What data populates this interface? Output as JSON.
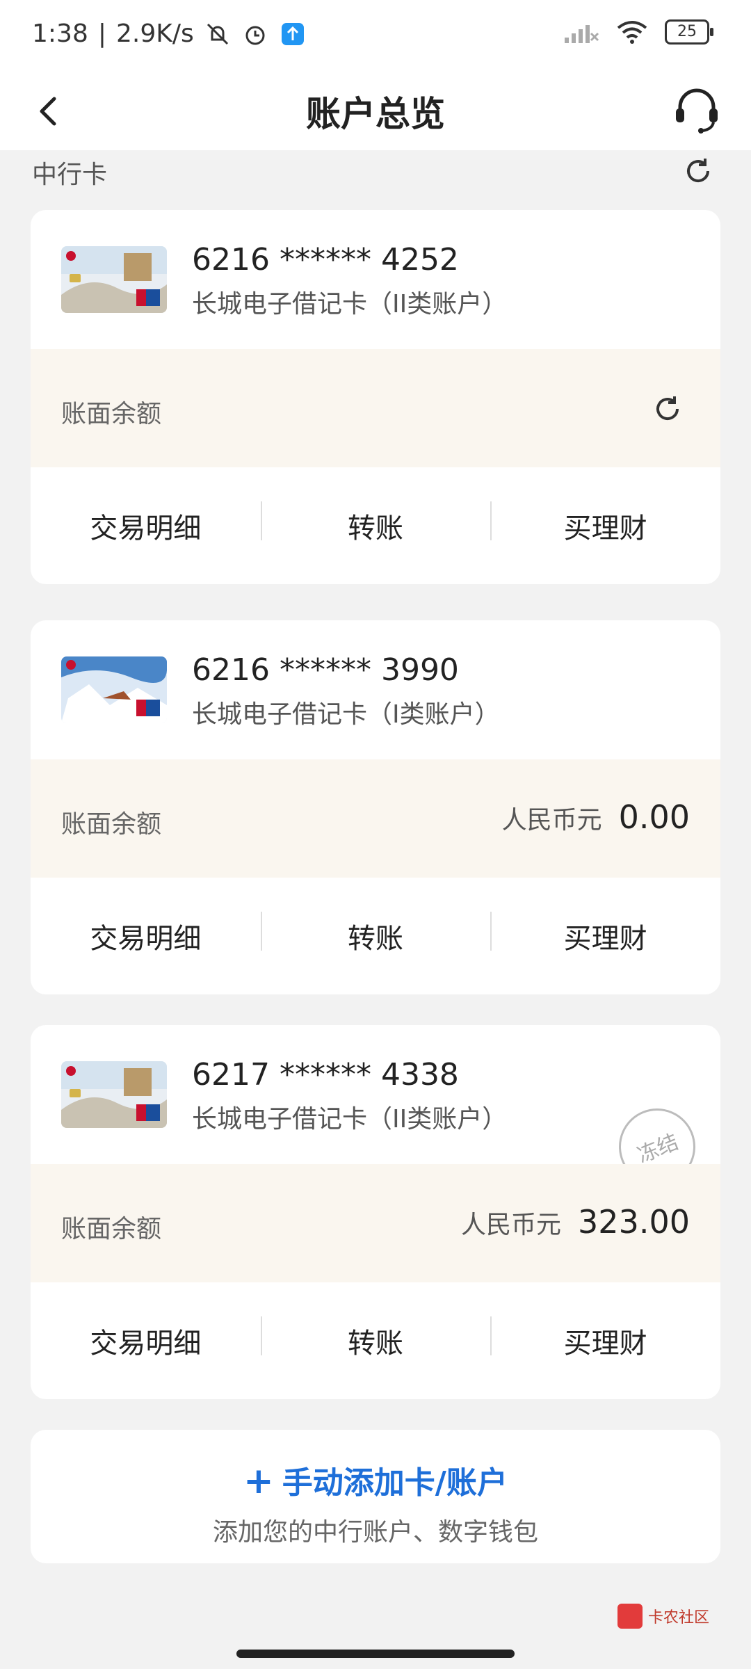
{
  "statusbar": {
    "time": "1:38",
    "separator": "|",
    "speed": "2.9K/s",
    "battery": "25"
  },
  "nav": {
    "title": "账户总览"
  },
  "section": {
    "title": "中行卡"
  },
  "cards": [
    {
      "number": "6216 ****** 4252",
      "name": "长城电子借记卡（II类账户）",
      "balance_label": "账面余额",
      "currency": "",
      "amount": "",
      "actions": [
        "交易明细",
        "转账",
        "买理财"
      ]
    },
    {
      "number": "6216 ****** 3990",
      "name": "长城电子借记卡（I类账户）",
      "balance_label": "账面余额",
      "currency": "人民币元",
      "amount": "0.00",
      "actions": [
        "交易明细",
        "转账",
        "买理财"
      ]
    },
    {
      "number": "6217 ****** 4338",
      "name": "长城电子借记卡（II类账户）",
      "badge": "冻结",
      "balance_label": "账面余额",
      "currency": "人民币元",
      "amount": "323.00",
      "actions": [
        "交易明细",
        "转账",
        "买理财"
      ]
    }
  ],
  "add": {
    "plus": "+",
    "title": "手动添加卡/账户",
    "subtitle": "添加您的中行账户、数字钱包"
  },
  "watermark": {
    "text": "卡农社区"
  },
  "colors": {
    "accent": "#1e6fd9",
    "balance_bg": "#faf6ef",
    "page_bg": "#f2f2f2"
  }
}
